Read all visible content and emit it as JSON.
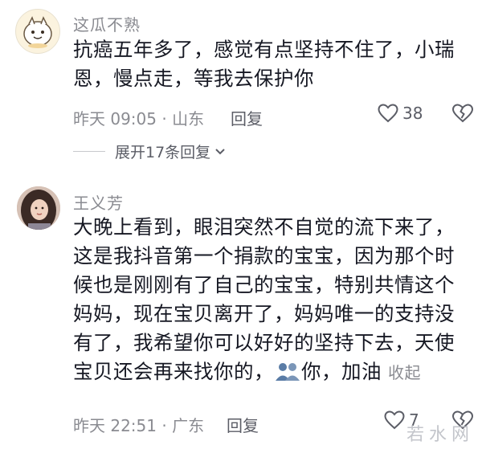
{
  "comments": [
    {
      "username": "这瓜不熟",
      "text_lines": [
        "抗癌五年多了，感觉有点坚持不住了，小瑞",
        "恩，慢点走，等我去保护你"
      ],
      "time_location": "昨天 09:05 · 山东",
      "reply_label": "回复",
      "like_count": "38",
      "expand_label": "展开17条回复"
    },
    {
      "username": "王义芳",
      "text_lines": [
        "大晚上看到，眼泪突然不自觉的流下来了，",
        "这是我抖音第一个捐款的宝宝，因为那个时",
        "候也是刚刚有了自己的宝宝，特别共情这个",
        "妈妈，现在宝贝离开了，妈妈唯一的支持没",
        "有了，我希望你可以好好的坚持下去，天使"
      ],
      "last_line_before_emoji": "宝贝还会再来找你的，",
      "last_line_after_emoji": "你，加油",
      "collapse_label": "收起",
      "time_location": "昨天 22:51 · 广东",
      "reply_label": "回复",
      "like_count": "7"
    }
  ],
  "watermark": "若水网",
  "icons": {
    "like": "heart-outline-icon",
    "dislike": "broken-heart-icon",
    "expand": "chevron-down-icon",
    "emoji": "hug-emoji-icon"
  }
}
